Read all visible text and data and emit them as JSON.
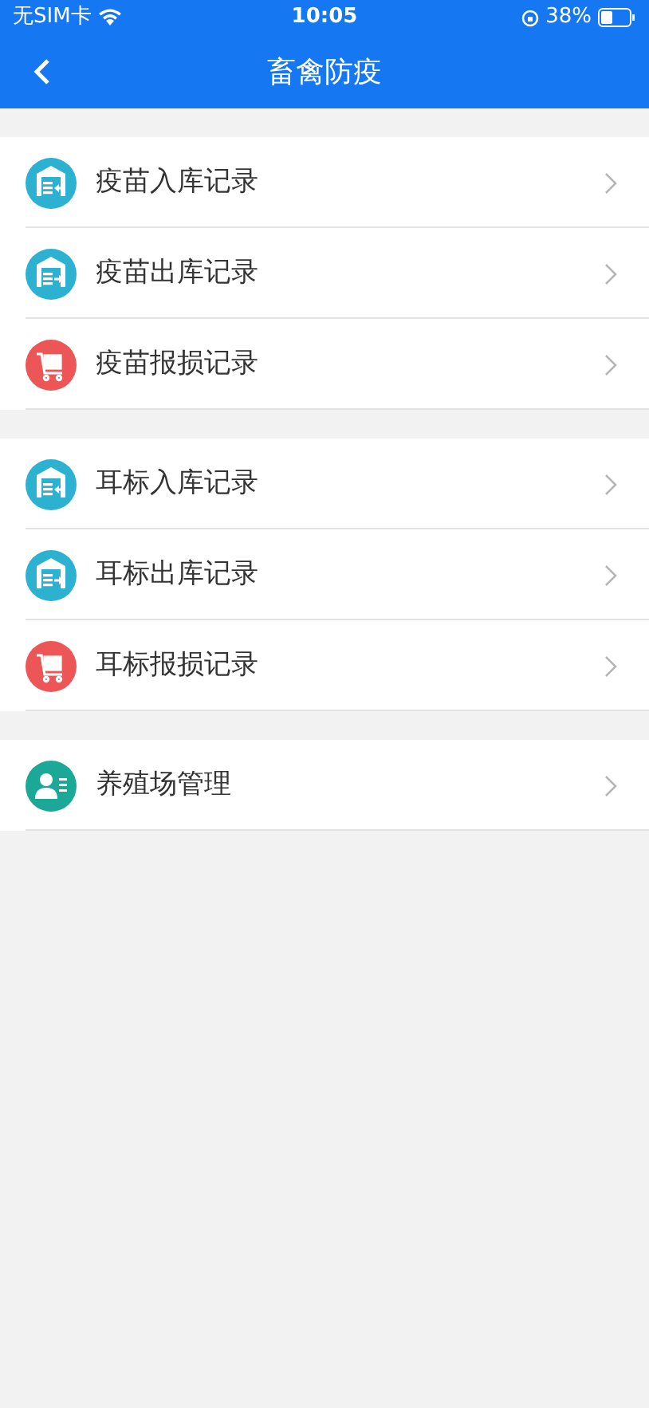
{
  "status_bar": {
    "carrier": "无SIM卡",
    "time": "10:05",
    "battery": "38%"
  },
  "nav": {
    "title": "畜禽防疫"
  },
  "groups": [
    {
      "items": [
        {
          "label": "疫苗入库记录",
          "kind": "in",
          "color": "#2cb2d0"
        },
        {
          "label": "疫苗出库记录",
          "kind": "out",
          "color": "#2cb2d0"
        },
        {
          "label": "疫苗报损记录",
          "kind": "damage",
          "color": "#ec5656"
        }
      ]
    },
    {
      "items": [
        {
          "label": "耳标入库记录",
          "kind": "in",
          "color": "#2cb2d0"
        },
        {
          "label": "耳标出库记录",
          "kind": "out",
          "color": "#2cb2d0"
        },
        {
          "label": "耳标报损记录",
          "kind": "damage",
          "color": "#ec5656"
        }
      ]
    },
    {
      "items": [
        {
          "label": "养殖场管理",
          "kind": "farm",
          "color": "#1ba897"
        }
      ]
    }
  ]
}
